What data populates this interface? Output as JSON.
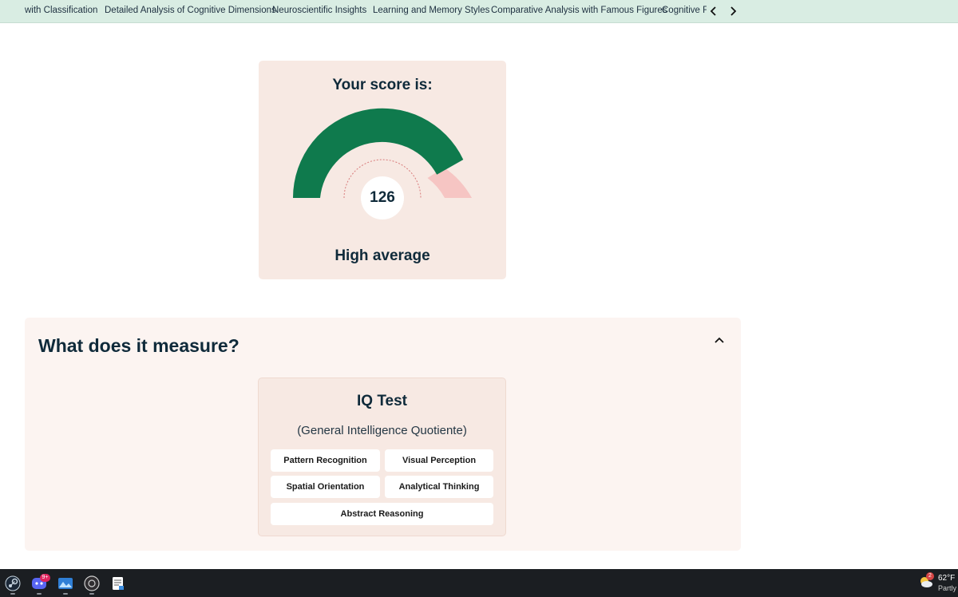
{
  "nav": {
    "tabs": [
      "with Classification",
      "Detailed Analysis of Cognitive Dimensions",
      "Neuroscientific Insights",
      "Learning and Memory Styles",
      "Comparative Analysis with Famous Figures",
      "Cognitive Fl"
    ],
    "prev_icon": "chevron-left-icon",
    "next_icon": "chevron-right-icon"
  },
  "score_card": {
    "title": "Your score is:",
    "score": "126",
    "classification": "High average",
    "gauge_fill_fraction": 0.83,
    "colors": {
      "fill": "#0f7a4d",
      "remainder": "#f6c5c3",
      "background": "#f7e9e3"
    }
  },
  "measure_section": {
    "title": "What does it measure?",
    "collapse_icon": "chevron-up-icon",
    "test_card": {
      "title": "IQ Test",
      "subtitle": "(General Intelligence Quotiente)",
      "skills": [
        "Pattern Recognition",
        "Visual Perception",
        "Spatial Orientation",
        "Analytical Thinking",
        "Abstract Reasoning"
      ]
    }
  },
  "taskbar": {
    "apps": [
      "steam-icon",
      "discord-icon",
      "photos-icon",
      "obs-icon",
      "notepad-icon"
    ],
    "discord_badge": "9+",
    "weather": {
      "temperature": "62°F",
      "condition": "Partly",
      "alert_count": "2"
    }
  }
}
